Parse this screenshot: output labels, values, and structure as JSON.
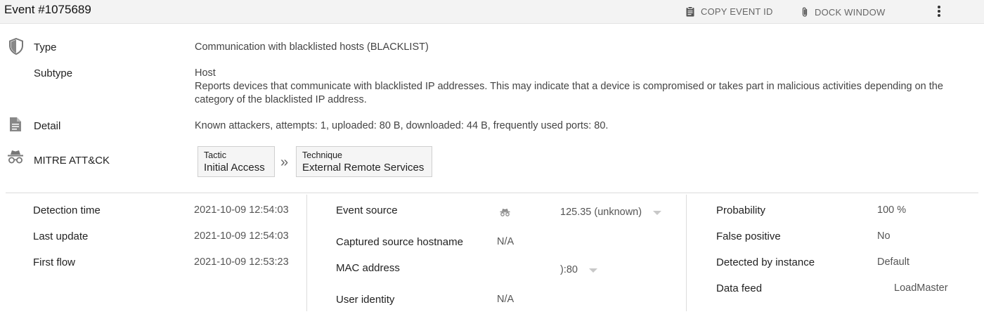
{
  "title": "Event #1075689",
  "toolbar": {
    "copy_label": "COPY EVENT ID",
    "dock_label": "DOCK WINDOW"
  },
  "type": {
    "label": "Type",
    "value": "Communication with blacklisted hosts (BLACKLIST)"
  },
  "subtype": {
    "label": "Subtype",
    "value": "Host",
    "description": "Reports devices that communicate with blacklisted IP addresses. This may indicate that a device is compromised or takes part in malicious activities depending on the category of the blacklisted IP address."
  },
  "detail": {
    "label": "Detail",
    "value": "Known attackers, attempts: 1, uploaded: 80 B, downloaded: 44 B, frequently used ports: 80."
  },
  "mitre": {
    "label": "MITRE ATT&CK",
    "tactic_key": "Tactic",
    "tactic_value": "Initial Access",
    "technique_key": "Technique",
    "technique_value": "External Remote Services"
  },
  "left_col": {
    "detection_time_label": "Detection time",
    "detection_time": "2021-10-09 12:54:03",
    "last_update_label": "Last update",
    "last_update": "2021-10-09 12:54:03",
    "first_flow_label": "First flow",
    "first_flow": "2021-10-09 12:53:23"
  },
  "mid_col": {
    "event_source_label": "Event source",
    "event_source": "125.35 (unknown)",
    "hostname_label": "Captured source hostname",
    "hostname": "N/A",
    "mac_label": "MAC address",
    "mac": "):80",
    "user_identity_label": "User identity",
    "user_identity": "N/A"
  },
  "right_col": {
    "probability_label": "Probability",
    "probability": "100 %",
    "false_positive_label": "False positive",
    "false_positive": "No",
    "instance_label": "Detected by instance",
    "instance": "Default",
    "data_feed_label": "Data feed",
    "data_feed": "LoadMaster"
  },
  "colors": {
    "titlebar_bg": "#f3f3f3",
    "chip_bg": "#f5f5f5",
    "divider": "#dcdcdc"
  },
  "icons": [
    "clipboard-icon",
    "paperclip-icon",
    "more-vertical-icon",
    "shield-icon",
    "document-icon",
    "spy-icon",
    "incognito-icon",
    "chevron-double-right-icon",
    "caret-down-icon"
  ]
}
